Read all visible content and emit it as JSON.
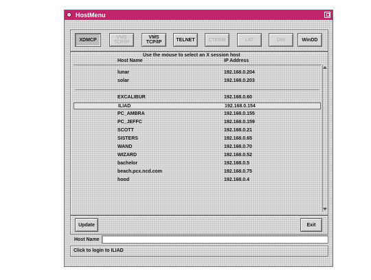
{
  "window": {
    "title": "HostMenu"
  },
  "protocol_buttons": [
    {
      "label": "XDMCP",
      "selected": true,
      "enabled": true
    },
    {
      "label": "VMS TCP/IP",
      "selected": false,
      "enabled": false
    },
    {
      "label": "VMS TCP/IP",
      "selected": false,
      "enabled": true
    },
    {
      "label": "TELNET",
      "selected": false,
      "enabled": true
    },
    {
      "label": "CTERM",
      "selected": false,
      "enabled": false
    },
    {
      "label": "LAT",
      "selected": false,
      "enabled": false
    },
    {
      "label": "DIN",
      "selected": false,
      "enabled": false
    },
    {
      "label": "WinDD",
      "selected": false,
      "enabled": true
    }
  ],
  "list": {
    "instruction": "Use the mouse to select an X session host",
    "col_name": "Host Name",
    "col_ip": "IP Address",
    "group1": [
      {
        "name": "lunar",
        "ip": "192.168.0.204"
      },
      {
        "name": "solar",
        "ip": "192.168.0.203"
      }
    ],
    "group2": [
      {
        "name": "EXCALIBUR",
        "ip": "192.168.0.60"
      },
      {
        "name": "ILIAD",
        "ip": "192.168.0.154",
        "selected": true
      },
      {
        "name": "PC_AMBRA",
        "ip": "192.168.0.155"
      },
      {
        "name": "PC_JEFFC",
        "ip": "192.168.0.159"
      },
      {
        "name": "SCOTT",
        "ip": "192.168.0.21"
      },
      {
        "name": "SISTERS",
        "ip": "192.168.0.65"
      },
      {
        "name": "WAND",
        "ip": "192.168.0.70"
      },
      {
        "name": "WIZARD",
        "ip": "192.168.0.52"
      },
      {
        "name": "bachelor",
        "ip": "192.168.0.5"
      },
      {
        "name": "beach.pcx.ncd.com",
        "ip": "192.168.0.75"
      },
      {
        "name": "hood",
        "ip": "192.168.0.4"
      }
    ]
  },
  "actions": {
    "update": "Update",
    "exit": "Exit"
  },
  "host_field": {
    "label": "Host Name",
    "value": ""
  },
  "status": "Click to login to ILIAD"
}
